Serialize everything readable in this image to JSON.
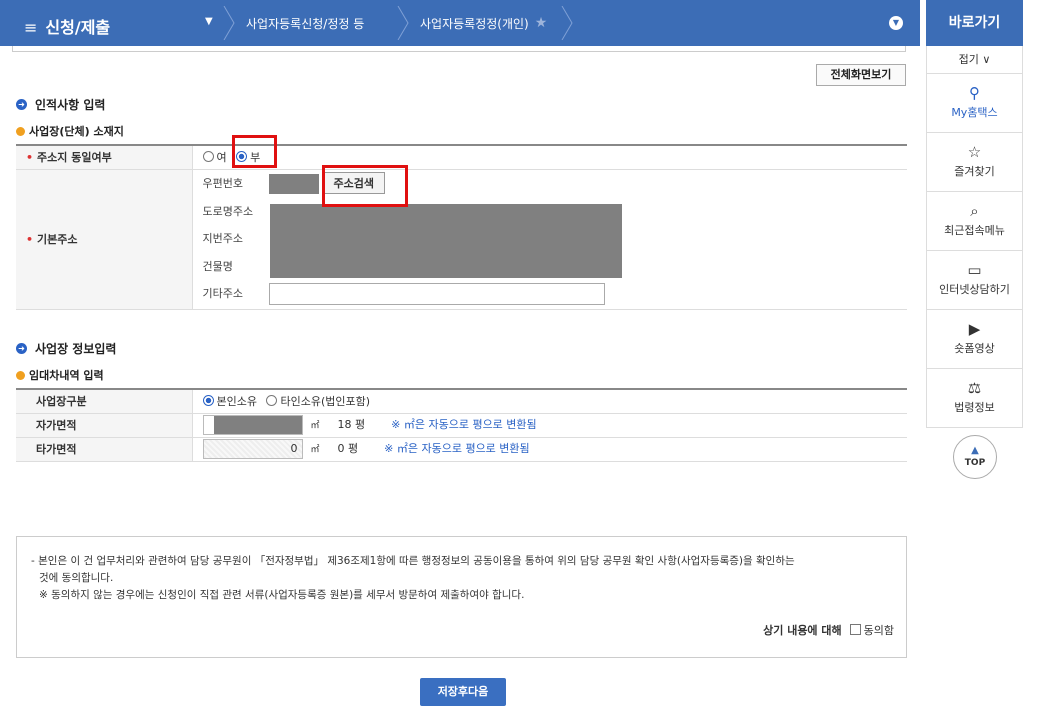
{
  "topbar": {
    "menu_label": "신청/제출",
    "breadcrumb": [
      "사업자등록신청/정정 등",
      "사업자등록정정(개인)"
    ]
  },
  "fullview_label": "전체화면보기",
  "personal_section": {
    "title": "인적사항 입력",
    "subtitle": "사업장(단체) 소재지",
    "same_address_label": "주소지 동일여부",
    "yes_label": "여",
    "no_label": "부",
    "base_address_label": "기본주소",
    "postcode_label": "우편번호",
    "address_search_button": "주소검색",
    "road_address_label": "도로명주소",
    "lot_address_label": "지번주소",
    "building_label": "건물명",
    "other_address_label": "기타주소"
  },
  "business_section": {
    "title": "사업장 정보입력",
    "subtitle": "임대차내역 입력",
    "site_type_label": "사업장구분",
    "own_label": "본인소유",
    "other_owner_label": "타인소유(법인포함)",
    "own_area_label": "자가면적",
    "own_area_unit": "㎡",
    "own_area_pyeong": "18 평",
    "other_area_label": "타가면적",
    "other_area_value": "0",
    "other_area_unit": "㎡",
    "other_area_pyeong": "0 평",
    "conversion_note": "※ ㎡은 자동으로 평으로 변환됨"
  },
  "agreement": {
    "line1": "- 본인은 이 건 업무처리와 관련하여 담당 공무원이 「전자정부법」 제36조제1항에 따른 행정정보의 공동이용을 통하여 위의 담당 공무원 확인 사항(사업자등록증)을 확인하는",
    "line2": "것에 동의합니다.",
    "line3": "※ 동의하지 않는 경우에는 신청인이 직접 관련 서류(사업자등록증 원본)를 세무서 방문하여 제출하여야 합니다.",
    "agree_prompt": "상기 내용에 대해",
    "agree_label": "동의함"
  },
  "save_button": "저장후다음",
  "sidebar": {
    "title": "바로가기",
    "fold": "접기",
    "items": [
      "My홈택스",
      "즐겨찾기",
      "최근접속메뉴",
      "인터넷상담하기",
      "숏폼영상",
      "법령정보"
    ],
    "top": "TOP"
  }
}
